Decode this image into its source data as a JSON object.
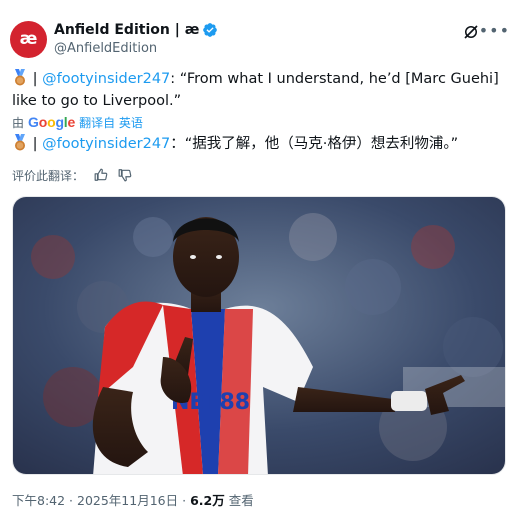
{
  "header": {
    "avatar_text": "æ",
    "display_name": "Anfield Edition | æ",
    "handle": "@AnfieldEdition",
    "icons": [
      "verified-badge-icon",
      "grok-icon",
      "more-icon"
    ],
    "more_label": "•••"
  },
  "tweet": {
    "mention": "@footyinsider247",
    "separator": " | ",
    "quote": ": “From what I understand, he’d [Marc Guehi] like to go to Liverpool.”"
  },
  "translation_bar": {
    "prefix": "由",
    "provider": "Google",
    "action": "翻译自 英语"
  },
  "translated": {
    "mention": "@footyinsider247",
    "separator": " | ",
    "text": "：“据我了解，他（马克·格伊）想去利物浦。”"
  },
  "rating": {
    "label": "评价此翻译：",
    "icons": [
      "thumbs-up-icon",
      "thumbs-down-icon"
    ]
  },
  "media": {
    "shirt_text": "NET88"
  },
  "meta": {
    "time": "下午8:42 · 2025年11月16日 ·",
    "views": "6.2万",
    "views_label": "查看"
  },
  "colors": {
    "accent": "#1d9bf0",
    "avatar": "#d3232f",
    "muted": "#536471"
  }
}
